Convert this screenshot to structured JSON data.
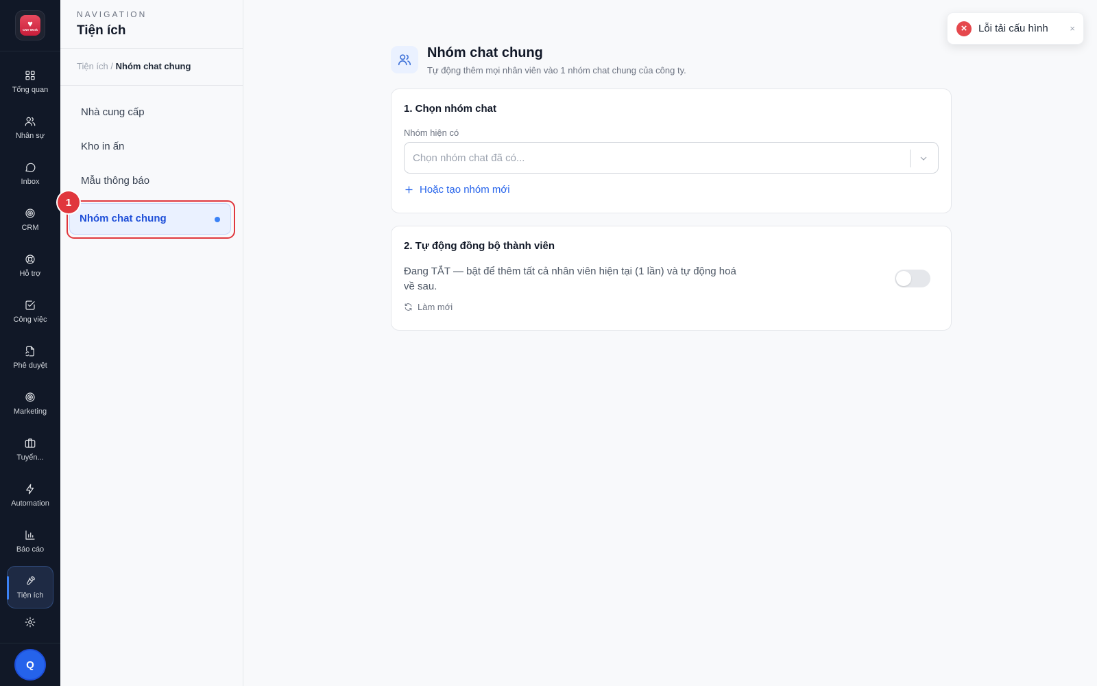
{
  "rail": {
    "logo_text": "CNV Work",
    "items": [
      {
        "label": "Tổng quan",
        "icon": "grid-icon"
      },
      {
        "label": "Nhân sự",
        "icon": "users-icon"
      },
      {
        "label": "Inbox",
        "icon": "chat-bubble-icon"
      },
      {
        "label": "CRM",
        "icon": "target-icon"
      },
      {
        "label": "Hỗ trợ",
        "icon": "lifebuoy-icon"
      },
      {
        "label": "Công việc",
        "icon": "checkbox-icon"
      },
      {
        "label": "Phê duyệt",
        "icon": "file-sync-icon"
      },
      {
        "label": "Marketing",
        "icon": "bullseye-icon"
      },
      {
        "label": "Tuyển...",
        "icon": "briefcase-icon"
      },
      {
        "label": "Automation",
        "icon": "lightning-icon"
      },
      {
        "label": "Báo cáo",
        "icon": "bar-chart-icon"
      },
      {
        "label": "Tiện ích",
        "icon": "wrench-icon"
      }
    ],
    "settings_icon": "gear-icon",
    "avatar_initial": "Q"
  },
  "subnav": {
    "kicker": "NAVIGATION",
    "title": "Tiện ích",
    "breadcrumb_parent": "Tiện ích",
    "breadcrumb_sep": "/",
    "breadcrumb_current": "Nhóm chat chung",
    "items": [
      "Nhà cung cấp",
      "Kho in ấn",
      "Mẫu thông báo"
    ],
    "active_item": "Nhóm chat chung",
    "step_badge": "1"
  },
  "page": {
    "title": "Nhóm chat chung",
    "subtitle": "Tự động thêm mọi nhân viên vào 1 nhóm chat chung của công ty.",
    "section1": {
      "title": "1. Chọn nhóm chat",
      "field_label": "Nhóm hiện có",
      "select_placeholder": "Chọn nhóm chat đã có...",
      "create_link": "Hoặc tạo nhóm mới"
    },
    "section2": {
      "title": "2. Tự động đồng bộ thành viên",
      "description": "Đang TẮT — bật để thêm tất cả nhân viên hiện tại (1 lần) và tự động hoá về sau.",
      "toggle_on": false,
      "refresh_label": "Làm mới"
    }
  },
  "toast": {
    "message": "Lỗi tải cấu hình",
    "close": "×"
  },
  "colors": {
    "accent": "#2563eb",
    "error": "#e0373d",
    "rail_bg": "#111827"
  }
}
